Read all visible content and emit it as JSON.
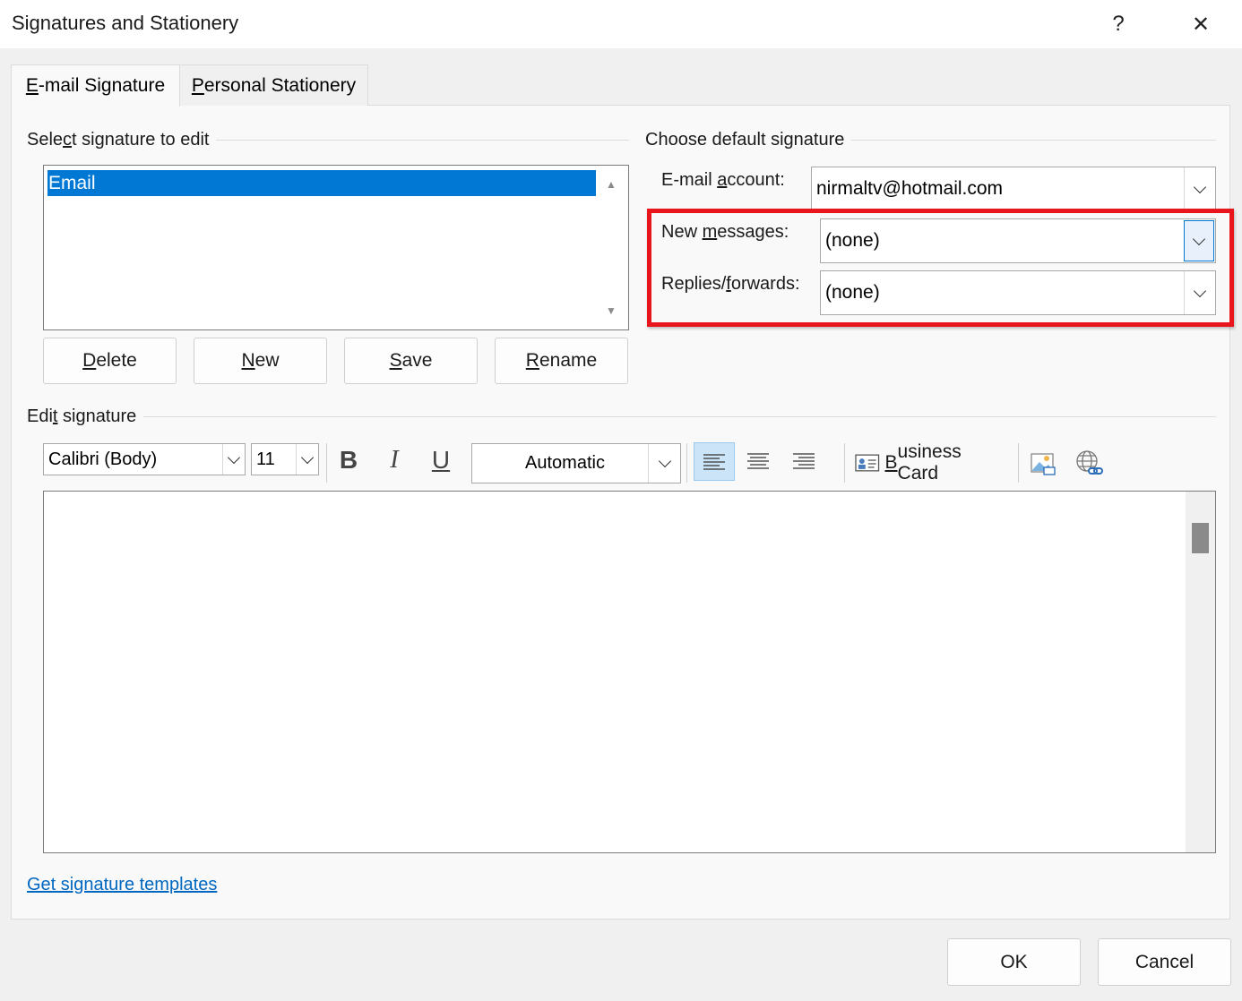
{
  "window": {
    "title": "Signatures and Stationery",
    "help_label": "?",
    "close_label": "✕"
  },
  "tabs": [
    {
      "label": "E-mail Signature",
      "accel": "E",
      "rest": "-mail Signature"
    },
    {
      "label": "Personal Stationery",
      "accel": "P",
      "rest": "ersonal Stationery"
    }
  ],
  "select_group": {
    "label_pre": "Sele",
    "label_accel": "c",
    "label_post": "t signature to edit"
  },
  "signatures": [
    "Email"
  ],
  "sig_buttons": [
    {
      "accel": "D",
      "rest": "elete"
    },
    {
      "accel": "N",
      "rest": "ew"
    },
    {
      "accel": "S",
      "rest": "ave"
    },
    {
      "accel": "R",
      "rest": "ename"
    }
  ],
  "default_group": {
    "label": "Choose default signature",
    "account_label_pre": "E-mail ",
    "account_label_accel": "a",
    "account_label_post": "ccount:",
    "account_value": "nirmaltv@hotmail.com",
    "new_label_pre": "New ",
    "new_label_accel": "m",
    "new_label_post": "essages:",
    "new_value": "(none)",
    "replies_label_pre": "Replies/",
    "replies_label_accel": "f",
    "replies_label_post": "orwards:",
    "replies_value": "(none)",
    "highlight_color": "#e8161c"
  },
  "edit_group": {
    "label_pre": "Edi",
    "label_accel": "t",
    "label_post": " signature",
    "font": "Calibri (Body)",
    "size": "11",
    "bold": "B",
    "italic": "I",
    "underline": "U",
    "color": "Automatic",
    "business_card_accel": "B",
    "business_card_rest": "usiness Card"
  },
  "footer": {
    "templates_link": "Get signature templates",
    "ok": "OK",
    "cancel": "Cancel"
  },
  "colors": {
    "accent": "#0078d4",
    "link": "#0067c0"
  }
}
